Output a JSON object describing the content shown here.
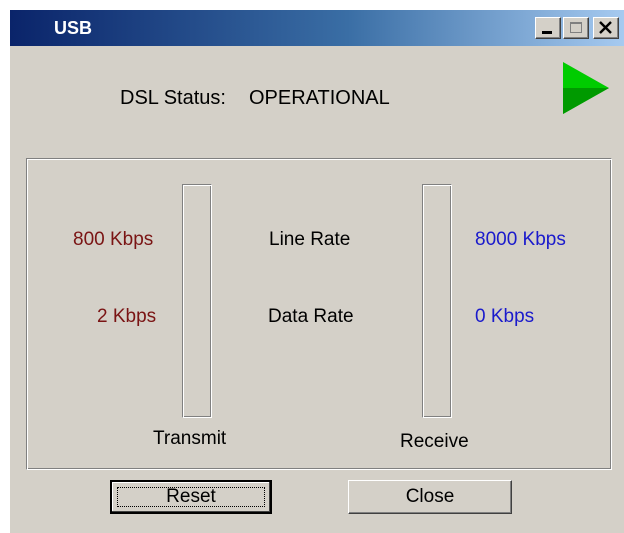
{
  "window": {
    "title": "USB",
    "controls": [
      "minimize-icon",
      "maximize-icon",
      "close-icon"
    ]
  },
  "status": {
    "label": "DSL Status:",
    "value": "OPERATIONAL",
    "indicator_icon": "green-play-arrow-icon",
    "indicator_color": "#00cc00"
  },
  "rates": {
    "line_rate_label": "Line Rate",
    "data_rate_label": "Data Rate",
    "transmit": {
      "label": "Transmit",
      "line_rate": "800 Kbps",
      "data_rate": "2 Kbps",
      "color": "#7a1414",
      "meter_level": 0
    },
    "receive": {
      "label": "Receive",
      "line_rate": "8000 Kbps",
      "data_rate": "0 Kbps",
      "color": "#1a1acc",
      "meter_level": 0
    }
  },
  "buttons": {
    "reset_label": "Reset",
    "close_label": "Close"
  }
}
